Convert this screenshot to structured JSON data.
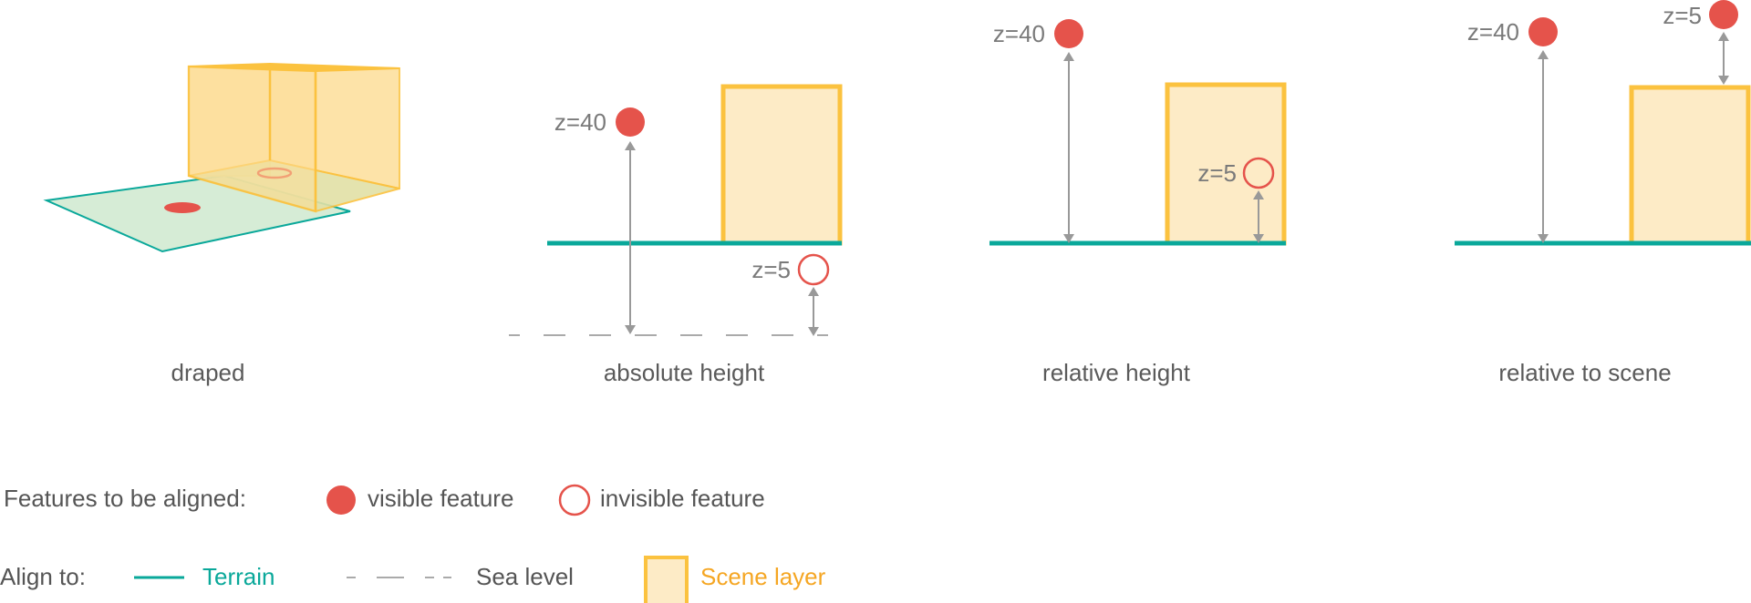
{
  "colors": {
    "feature": "#e5534b",
    "terrain": "#0aa89a",
    "terrain_fill": "#d6ecd6",
    "scene_stroke": "#fbc23f",
    "scene_fill": "#fdebc6",
    "scene_fill_3d": "#fddf99",
    "arrow": "#999999",
    "sea_level": "#aaaaaa",
    "text": "#5a5a5a",
    "scene_text": "#f5a623"
  },
  "panels": [
    {
      "id": "draped",
      "caption": "draped"
    },
    {
      "id": "absolute",
      "caption": "absolute height",
      "labels": {
        "visible": "z=40",
        "invisible": "z=5"
      }
    },
    {
      "id": "relative",
      "caption": "relative height",
      "labels": {
        "visible": "z=40",
        "invisible": "z=5"
      }
    },
    {
      "id": "relscene",
      "caption": "relative to scene",
      "labels": {
        "visible": "z=40",
        "scene_feature": "z=5"
      }
    }
  ],
  "legend": {
    "features_title": "Features to be aligned:",
    "visible_feature": "visible feature",
    "invisible_feature": "invisible feature",
    "align_title": "Align to:",
    "terrain": "Terrain",
    "sea_level": "Sea level",
    "scene_layer": "Scene layer"
  }
}
